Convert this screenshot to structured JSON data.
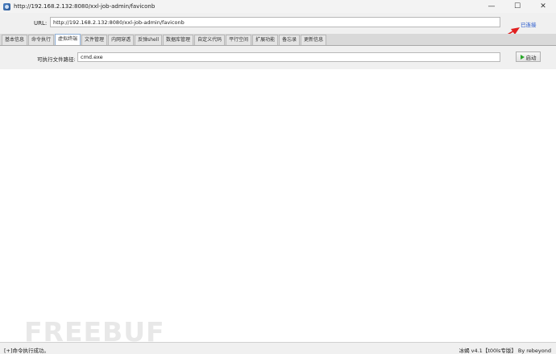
{
  "window": {
    "title": "http://192.168.2.132:8080/xxl-job-admin/faviconb",
    "minimize": "—",
    "maximize": "☐",
    "close": "✕"
  },
  "toolbar": {
    "url_label": "URL:",
    "url_value": "http://192.168.2.132:8080/xxl-job-admin/faviconb",
    "status": "已连接"
  },
  "tabs": [
    {
      "label": "基本信息"
    },
    {
      "label": "命令执行"
    },
    {
      "label": "虚拟终端",
      "active": true
    },
    {
      "label": "文件管理"
    },
    {
      "label": "内网穿透"
    },
    {
      "label": "反弹shell"
    },
    {
      "label": "数据库管理"
    },
    {
      "label": "自定义代码"
    },
    {
      "label": "平行空间"
    },
    {
      "label": "扩展功能"
    },
    {
      "label": "备忘录"
    },
    {
      "label": "更新信息"
    }
  ],
  "terminal": {
    "path_label": "可执行文件路径:",
    "path_value": "cmd.exe",
    "start_label": "启动"
  },
  "watermark": "FREEBUF",
  "statusbar": {
    "left": "[+]命令执行成功。",
    "right": "冰蝎 v4.1【t00ls专版】   By rebeyond"
  },
  "colors": {
    "link": "#2255cc",
    "arrow": "#e02020",
    "play": "#2aa82a"
  }
}
